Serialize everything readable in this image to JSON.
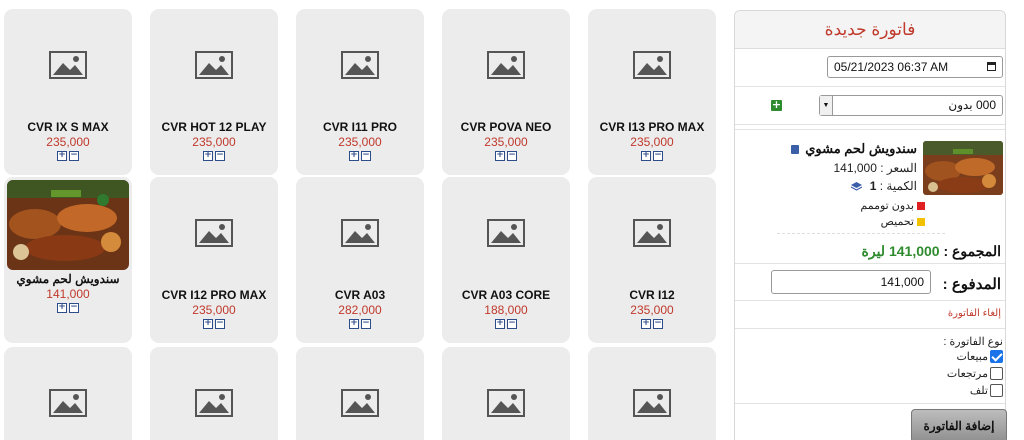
{
  "products": [
    {
      "name": "CVR I13 PRO MAX",
      "price": "235,000",
      "image": "placeholder"
    },
    {
      "name": "CVR POVA NEO",
      "price": "235,000",
      "image": "placeholder"
    },
    {
      "name": "CVR I11 PRO",
      "price": "235,000",
      "image": "placeholder"
    },
    {
      "name": "CVR HOT 12 PLAY",
      "price": "235,000",
      "image": "placeholder"
    },
    {
      "name": "CVR IX S MAX",
      "price": "235,000",
      "image": "placeholder"
    },
    {
      "name": "CVR I12",
      "price": "235,000",
      "image": "placeholder"
    },
    {
      "name": "CVR A03 CORE",
      "price": "188,000",
      "image": "placeholder"
    },
    {
      "name": "CVR A03",
      "price": "282,000",
      "image": "placeholder"
    },
    {
      "name": "CVR I12 PRO MAX",
      "price": "235,000",
      "image": "placeholder"
    },
    {
      "name": "سندويش لحم مشوي",
      "price": "141,000",
      "image": "food-photo"
    },
    {
      "name": "",
      "price": "",
      "image": "placeholder"
    },
    {
      "name": "",
      "price": "",
      "image": "placeholder"
    },
    {
      "name": "",
      "price": "",
      "image": "placeholder"
    },
    {
      "name": "",
      "price": "",
      "image": "placeholder"
    },
    {
      "name": "",
      "price": "",
      "image": "placeholder"
    }
  ],
  "invoice": {
    "title": "فاتورة جديدة",
    "datetime": "05/21/2023 06:37 AM",
    "customer": "000 بدون",
    "item": {
      "name": "سندويش لحم مشوي",
      "price_text": "السعر : 141,000",
      "qty_label": "الكمية :",
      "qty": "1",
      "options": [
        "بدون توممم",
        "تحميص"
      ],
      "option_colors": [
        "#e02020",
        "#f2c200"
      ]
    },
    "total_label": "المجموع :",
    "total_value": "141,000 ليرة",
    "paid_label": "المدفوع :",
    "paid_value": "141,000",
    "cancel_label": "إلغاء الفاتورة",
    "type_label": "نوع الفاتورة :",
    "types": [
      {
        "label": "مبيعات",
        "checked": true
      },
      {
        "label": "مرتجعات",
        "checked": false
      },
      {
        "label": "تلف",
        "checked": false
      }
    ],
    "submit_label": "إضافة الفاتورة"
  },
  "colors": {
    "price": "#c0392b",
    "total": "#2e8b2e",
    "accent": "#1a73e8"
  }
}
